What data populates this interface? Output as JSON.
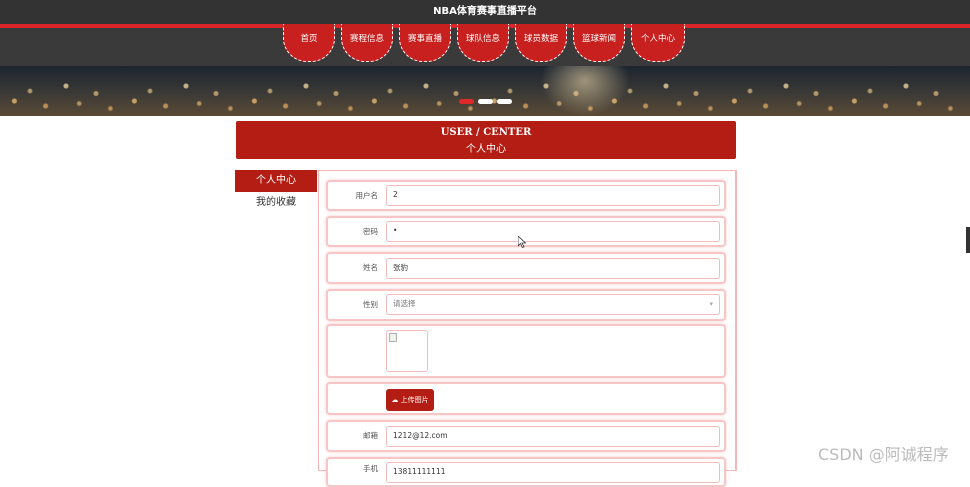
{
  "site": {
    "title": "NBA体育赛事直播平台"
  },
  "nav": {
    "items": [
      {
        "label": "首页"
      },
      {
        "label": "赛程信息"
      },
      {
        "label": "赛事直播"
      },
      {
        "label": "球队信息"
      },
      {
        "label": "球员数据"
      },
      {
        "label": "篮球新闻"
      },
      {
        "label": "个人中心"
      }
    ]
  },
  "carousel": {
    "dot_count": 3,
    "active_index": 0
  },
  "header": {
    "title_en": "USER / CENTER",
    "title_cn": "个人中心"
  },
  "sidebar": {
    "items": [
      {
        "label": "个人中心",
        "active": true
      },
      {
        "label": "我的收藏",
        "active": false
      }
    ]
  },
  "form": {
    "username": {
      "label": "用户名",
      "value": "2"
    },
    "password": {
      "label": "密码",
      "value": "•"
    },
    "name": {
      "label": "姓名",
      "value": "张豹"
    },
    "gender": {
      "label": "性别",
      "placeholder": "请选择"
    },
    "avatar": {
      "label": ""
    },
    "upload": {
      "label": "上传图片"
    },
    "email": {
      "label": "邮箱",
      "value": "1212@12.com"
    },
    "phone": {
      "label": "手机",
      "value": "13811111111"
    }
  },
  "watermark": {
    "text": "CSDN @阿诚程序"
  },
  "colors": {
    "brand_red": "#b41d14",
    "nav_dark": "#3a3a3a",
    "top_dark": "#333333",
    "accent_red": "#d9262b"
  }
}
